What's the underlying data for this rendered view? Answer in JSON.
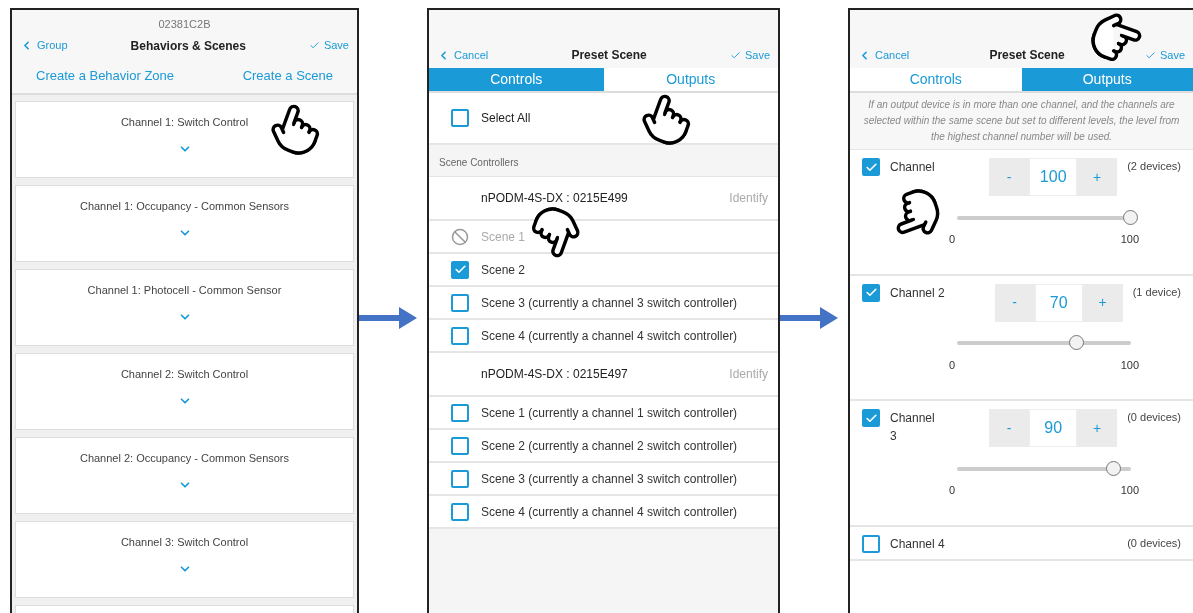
{
  "behaviors_screen": {
    "device_id": "02381C2B",
    "back": "Group",
    "title": "Behaviors & Scenes",
    "save": "Save",
    "actions": [
      "Create a Behavior Zone",
      "Create a Scene"
    ],
    "cards": [
      {
        "title": "Channel 1: Switch Control"
      },
      {
        "title": "Channel 1: Occupancy - Common Sensors"
      },
      {
        "title": "Channel 1: Photocell - Common Sensor"
      },
      {
        "title": "Channel 2: Switch Control"
      },
      {
        "title": "Channel 2: Occupancy - Common Sensors"
      },
      {
        "title": "Channel 3: Switch Control"
      }
    ]
  },
  "controls_screen": {
    "back": "Cancel",
    "title": "Preset Scene",
    "save": "Save",
    "tabs": [
      {
        "label": "Controls",
        "selected": true
      },
      {
        "label": "Outputs",
        "selected": false
      }
    ],
    "select_all": {
      "label": "Select All",
      "checked": false
    },
    "section": "Scene Controllers",
    "rows": [
      {
        "kind": "device",
        "label": "nPODM-4S-DX : 0215E499",
        "action": "Identify"
      },
      {
        "kind": "scene",
        "label": "Scene 1",
        "disabled": true
      },
      {
        "kind": "scene",
        "label": "Scene 2",
        "checked": true,
        "disabled": false
      },
      {
        "kind": "scene",
        "label": "Scene 3 (currently a channel 3 switch controller)",
        "checked": false,
        "disabled": false
      },
      {
        "kind": "scene",
        "label": "Scene 4 (currently a channel 4 switch controller)",
        "checked": false,
        "disabled": false
      },
      {
        "kind": "device",
        "label": "nPODM-4S-DX : 0215E497",
        "action": "Identify"
      },
      {
        "kind": "scene",
        "label": "Scene 1 (currently a channel 1 switch controller)",
        "checked": false,
        "disabled": false
      },
      {
        "kind": "scene",
        "label": "Scene 2 (currently a channel 2 switch controller)",
        "checked": false,
        "disabled": false
      },
      {
        "kind": "scene",
        "label": "Scene 3 (currently a channel 3 switch controller)",
        "checked": false,
        "disabled": false
      },
      {
        "kind": "scene",
        "label": "Scene 4 (currently a channel 4 switch controller)",
        "checked": false,
        "disabled": false
      }
    ]
  },
  "outputs_screen": {
    "back": "Cancel",
    "title": "Preset Scene",
    "save": "Save",
    "tabs": [
      {
        "label": "Controls",
        "selected": false
      },
      {
        "label": "Outputs",
        "selected": true
      }
    ],
    "note": "If an output device is in more than one channel, and the channels are selected within the same scene but set to different levels, the level from the highest channel number will be used.",
    "channels": [
      {
        "label": "Channel",
        "checked": true,
        "devices": "(2 devices)",
        "minus": "-",
        "value": "100",
        "plus": "+",
        "level": 1.0,
        "min": "0",
        "max": "100"
      },
      {
        "label": "Channel 2",
        "checked": true,
        "devices": "(1 device)",
        "minus": "-",
        "value": "70",
        "plus": "+",
        "level": 0.69,
        "min": "0",
        "max": "100"
      },
      {
        "label": "Channel 3",
        "checked": true,
        "devices": "(0 devices)",
        "minus": "-",
        "value": "90",
        "plus": "+",
        "level": 0.9,
        "min": "0",
        "max": "100"
      },
      {
        "label": "Channel 4",
        "checked": false,
        "devices": "(0 devices)"
      }
    ]
  }
}
